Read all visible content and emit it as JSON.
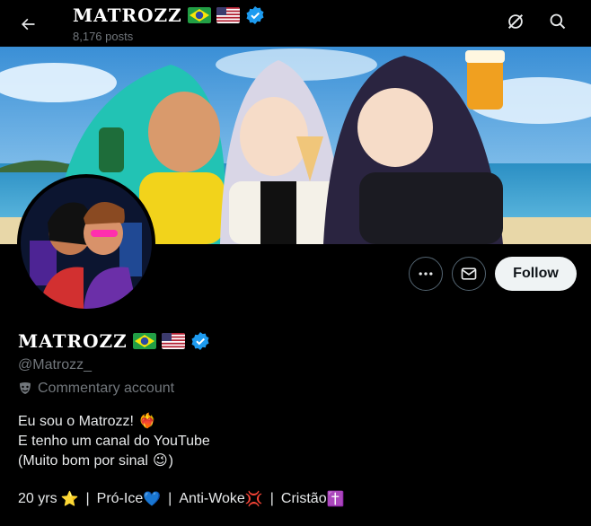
{
  "header": {
    "display_name": "MATROZZ",
    "posts_count": "8,176 posts"
  },
  "profile": {
    "display_name": "MATROZZ",
    "handle": "@Matrozz_",
    "category": "Commentary account",
    "bio_lines": [
      "Eu sou o Matrozz!",
      "E tenho um canal do YouTube",
      "(Muito bom por sinal"
    ],
    "bio_line3_close": ")",
    "tags": [
      "20 yrs",
      "Pró-Ice",
      "Anti-Woke",
      "Cristão"
    ]
  },
  "buttons": {
    "follow_label": "Follow"
  },
  "colors": {
    "background": "#000000",
    "text_primary": "#e7e9ea",
    "text_secondary": "#71767b",
    "verified_blue": "#1d9bf0",
    "follow_bg": "#eff3f4",
    "button_border": "#536471"
  },
  "icons": {
    "back": "arrow-left-icon",
    "grok": "grok-icon",
    "search": "search-icon",
    "more": "more-horizontal-icon",
    "message": "envelope-icon",
    "verified": "verified-badge-icon",
    "category": "theater-masks-icon"
  }
}
